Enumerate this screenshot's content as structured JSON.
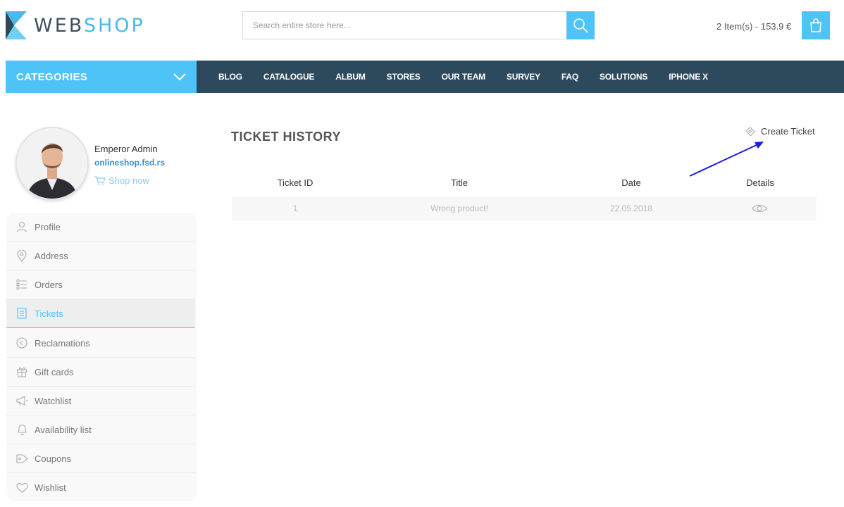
{
  "header": {
    "logo_part1": "WEB",
    "logo_part2": "SHOP",
    "search_placeholder": "Search entire store here...",
    "search_icon": "search-icon",
    "cart_summary": "2 Item(s) - 153.9 €",
    "cart_icon": "shopping-bag-icon"
  },
  "nav": {
    "categories_label": "CATEGORIES",
    "items": [
      "BLOG",
      "CATALOGUE",
      "ALBUM",
      "STORES",
      "OUR TEAM",
      "SURVEY",
      "FAQ",
      "SOLUTIONS",
      "IPHONE X"
    ]
  },
  "profile": {
    "name": "Emperor Admin",
    "site": "onlineshop.fsd.rs",
    "shop_now": "Shop now"
  },
  "sidebar": {
    "items": [
      {
        "label": "Profile",
        "icon": "user-icon"
      },
      {
        "label": "Address",
        "icon": "map-pin-icon"
      },
      {
        "label": "Orders",
        "icon": "list-icon"
      },
      {
        "label": "Tickets",
        "icon": "ticket-icon",
        "active": true
      },
      {
        "label": "Reclamations",
        "icon": "return-icon"
      },
      {
        "label": "Gift cards",
        "icon": "gift-icon"
      },
      {
        "label": "Watchlist",
        "icon": "megaphone-icon"
      },
      {
        "label": "Availability list",
        "icon": "bell-icon"
      },
      {
        "label": "Coupons",
        "icon": "tag-icon"
      },
      {
        "label": "Wishlist",
        "icon": "heart-icon"
      }
    ]
  },
  "main": {
    "title": "TICKET HISTORY",
    "create_ticket": "Create Ticket",
    "table": {
      "headers": [
        "Ticket ID",
        "Title",
        "Date",
        "Details"
      ],
      "rows": [
        {
          "id": "1",
          "title": "Wrong product!",
          "date": "22.05.2018",
          "details_icon": "eye-icon"
        }
      ]
    }
  },
  "colors": {
    "accent": "#4dc3f7",
    "nav_bg": "#2d4a5d",
    "annotation_arrow": "#1a1adf"
  }
}
